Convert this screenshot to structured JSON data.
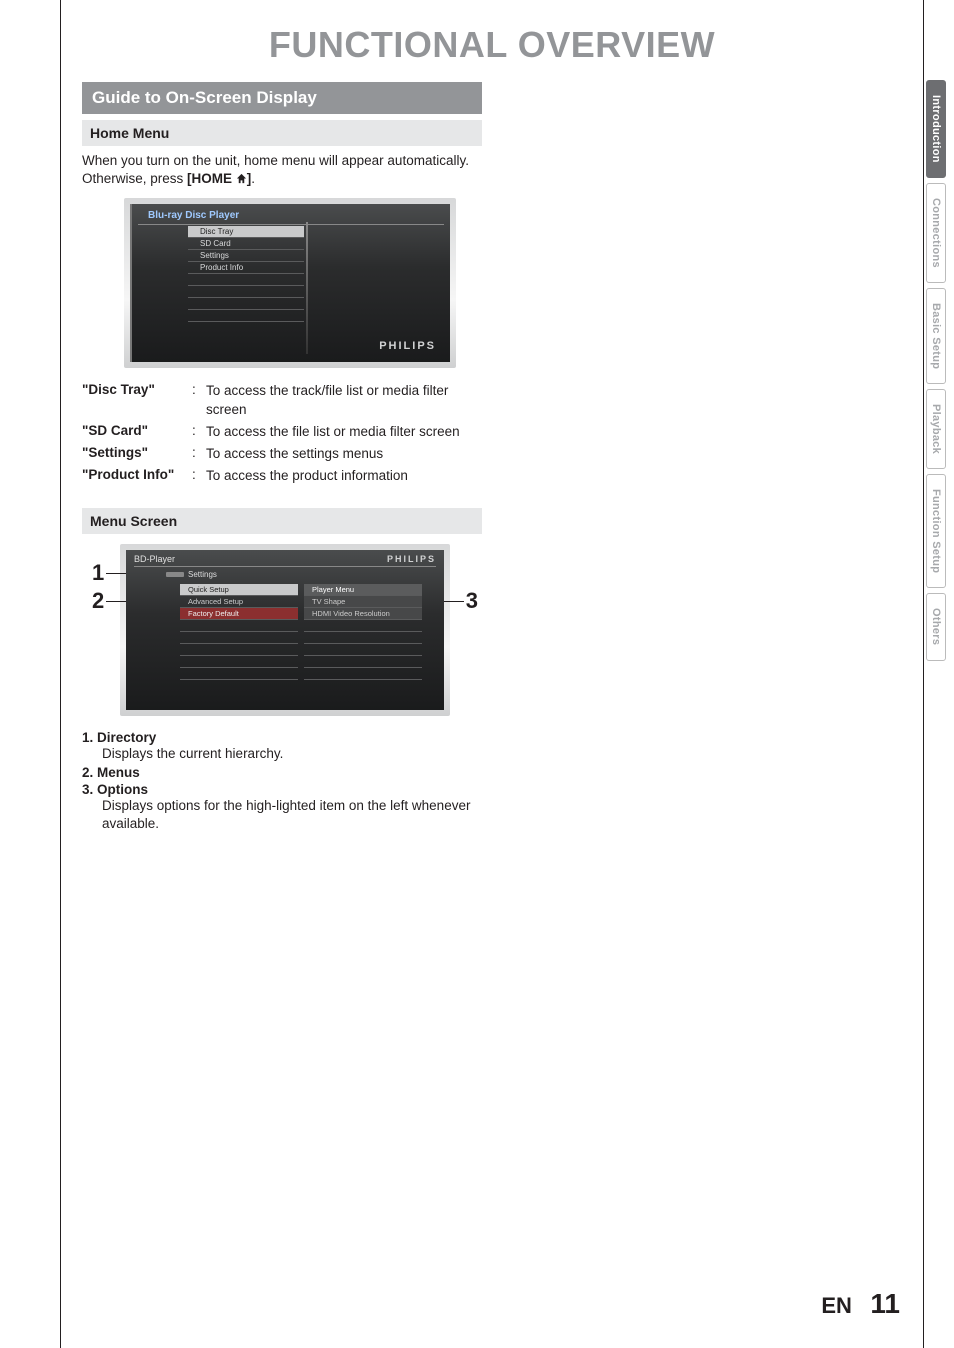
{
  "page_title": "FUNCTIONAL OVERVIEW",
  "section_title": "Guide to On-Screen Display",
  "home_menu": {
    "heading": "Home Menu",
    "intro_pre": "When you turn on the unit, home menu will appear automatically. Otherwise, press ",
    "intro_key": "[HOME ",
    "intro_key_close": "]",
    "intro_post": ".",
    "screen_header": "Blu-ray Disc Player",
    "items": [
      "Disc Tray",
      "SD Card",
      "Settings",
      "Product Info"
    ],
    "brand": "PHILIPS",
    "defs": [
      {
        "term": "\"Disc Tray\"",
        "desc": "To access the track/file list or media filter screen"
      },
      {
        "term": "\"SD Card\"",
        "desc": "To access the file list or media filter screen"
      },
      {
        "term": "\"Settings\"",
        "desc": "To access the settings menus"
      },
      {
        "term": "\"Product Info\"",
        "desc": "To access the product information"
      }
    ]
  },
  "menu_screen": {
    "heading": "Menu Screen",
    "top_label": "BD-Player",
    "brand": "PHILIPS",
    "crumb": "Settings",
    "left": [
      "Quick Setup",
      "Advanced Setup",
      "Factory Default"
    ],
    "right": [
      "Player Menu",
      "TV Shape",
      "HDMI Video Resolution"
    ],
    "callouts": {
      "c1": "1",
      "c2": "2",
      "c3": "3"
    },
    "list": [
      {
        "label": "1.  Directory",
        "desc": "Displays the current hierarchy."
      },
      {
        "label": "2.  Menus",
        "desc": ""
      },
      {
        "label": "3.  Options",
        "desc": "Displays options for the high-lighted item on the left whenever available."
      }
    ]
  },
  "tabs": [
    "Introduction",
    "Connections",
    "Basic Setup",
    "Playback",
    "Function Setup",
    "Others"
  ],
  "footer": {
    "lang": "EN",
    "page": "11"
  }
}
